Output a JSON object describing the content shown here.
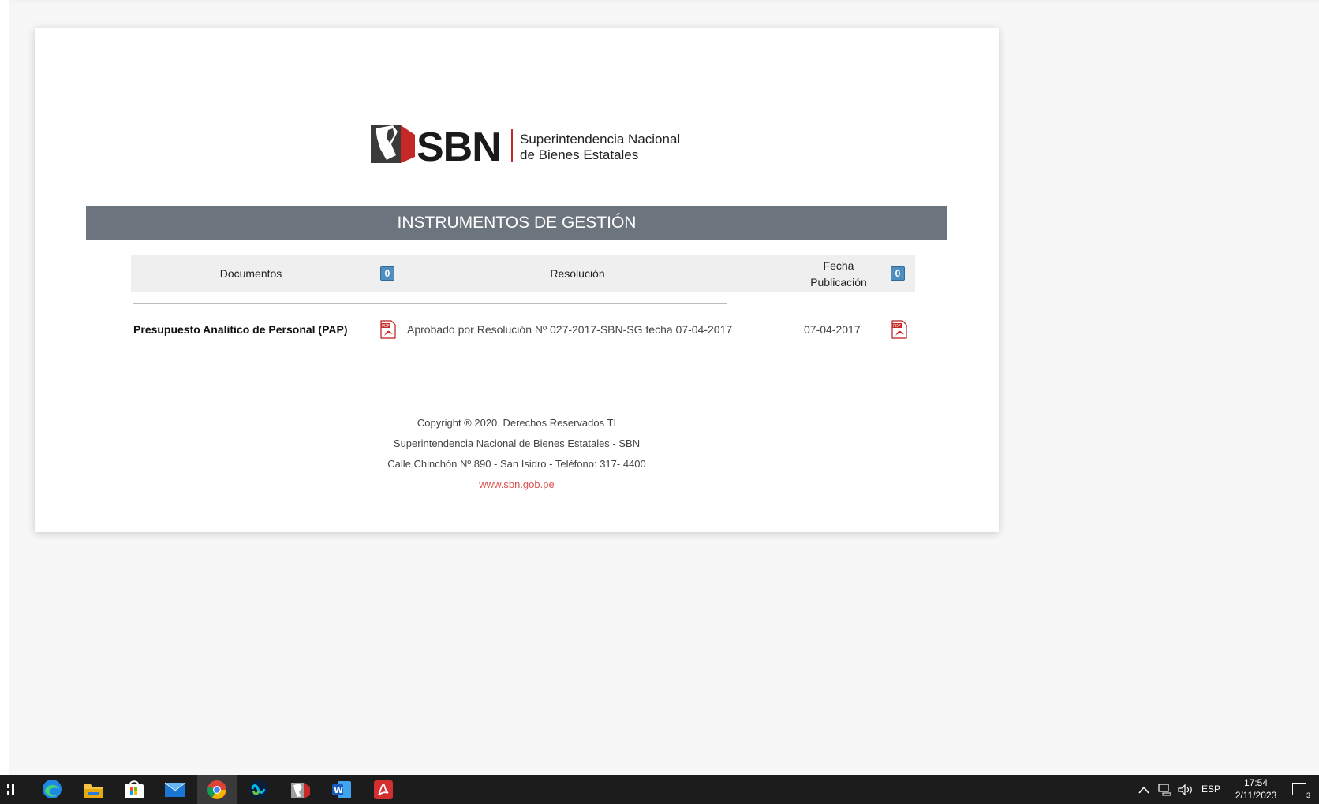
{
  "logo": {
    "short": "SBN",
    "line1": "Superintendencia Nacional",
    "line2": "de  Bienes  Estatales"
  },
  "banner": {
    "title": "INSTRUMENTOS DE GESTIÓN"
  },
  "table": {
    "headers": {
      "documentos": "Documentos",
      "resolucion": "Resolución",
      "fecha_line1": "Fecha",
      "fecha_line2": "Publicación"
    },
    "rows": [
      {
        "documento": "Presupuesto Analitico de Personal (PAP)",
        "resolucion": "Aprobado por Resolución Nº 027-2017-SBN-SG fecha 07-04-2017",
        "fecha": "07-04-2017"
      }
    ]
  },
  "footer": {
    "copyright": "Copyright ® 2020. Derechos Reservados TI",
    "entity": "Superintendencia Nacional de Bienes Estatales - SBN",
    "address": "Calle Chinchón Nº 890 - San Isidro - Teléfono: 317- 4400",
    "website": "www.sbn.gob.pe"
  },
  "taskbar": {
    "apps": [
      "task-view",
      "edge",
      "file-explorer",
      "microsoft-store",
      "mail",
      "chrome",
      "webex",
      "sbn-app",
      "word",
      "acrobat"
    ],
    "tray": {
      "language": "ESP",
      "time": "17:54",
      "date": "2/11/2023",
      "notifications": "3"
    }
  },
  "colors": {
    "banner": "#6c757d",
    "link": "#d9534f",
    "logo_red": "#c62828"
  }
}
